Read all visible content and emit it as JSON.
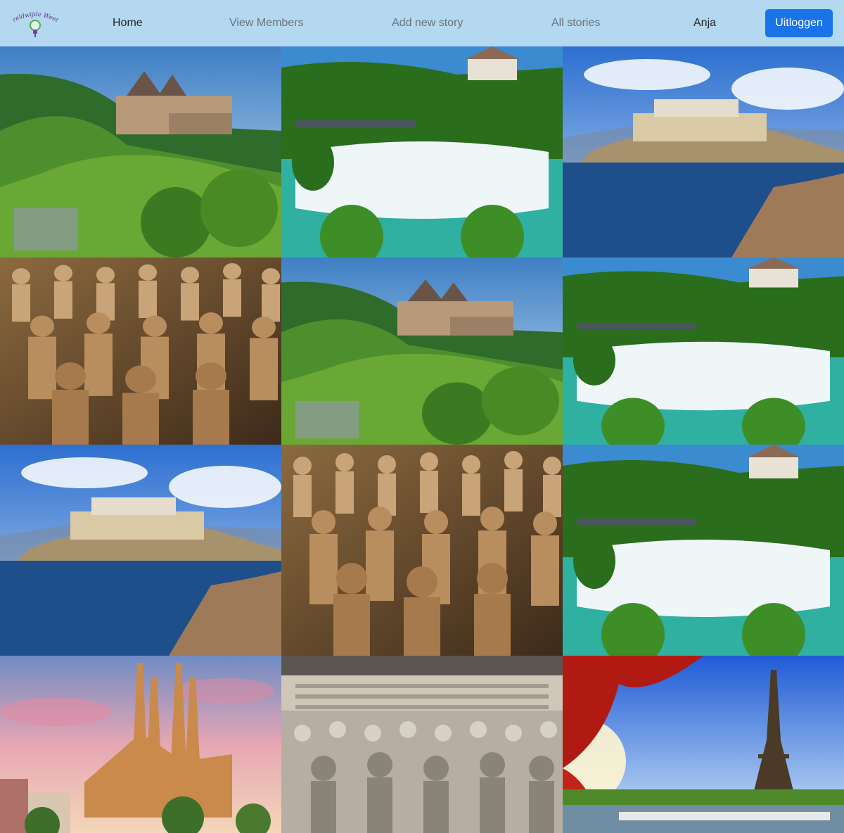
{
  "logo": {
    "text": "Wereldwijde Weetjes"
  },
  "nav": {
    "home": "Home",
    "members": "View Members",
    "add_story": "Add new story",
    "all_stories": "All stories",
    "user": "Anja",
    "logout": "Uitloggen"
  },
  "colors": {
    "navbar_bg": "#b3d8ef",
    "button_bg": "#1a73e8",
    "logo_text": "#6a2f8f",
    "logo_bulb": "#4caf50"
  },
  "gallery": [
    {
      "scene": "castle",
      "icon": "castle-photo"
    },
    {
      "scene": "waterfall",
      "icon": "waterfall-photo"
    },
    {
      "scene": "coast",
      "icon": "coastal-citadel-photo"
    },
    {
      "scene": "warriors",
      "icon": "terracotta-warriors-photo"
    },
    {
      "scene": "castle",
      "icon": "castle-photo"
    },
    {
      "scene": "waterfall",
      "icon": "waterfall-photo"
    },
    {
      "scene": "coast",
      "icon": "coastal-citadel-photo"
    },
    {
      "scene": "warriors",
      "icon": "terracotta-warriors-photo"
    },
    {
      "scene": "waterfall",
      "icon": "waterfall-photo"
    },
    {
      "scene": "cathedral",
      "icon": "cathedral-photo"
    },
    {
      "scene": "warriors_grey",
      "icon": "terracotta-army-hall-photo"
    },
    {
      "scene": "eiffel",
      "icon": "eiffel-tower-photo"
    }
  ]
}
